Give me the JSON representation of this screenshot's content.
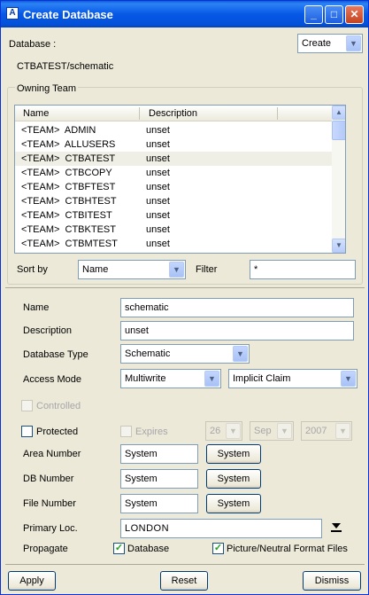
{
  "window": {
    "title": "Create Database",
    "icon_glyph": "A"
  },
  "database": {
    "label": "Database :",
    "mode": "Create",
    "path": "CTBATEST/schematic"
  },
  "owning_team": {
    "legend": "Owning Team",
    "columns": [
      "Name",
      "Description"
    ],
    "rows": [
      {
        "name": "<TEAM>  ADMIN",
        "description": "unset"
      },
      {
        "name": "<TEAM>  ALLUSERS",
        "description": "unset"
      },
      {
        "name": "<TEAM>  CTBATEST",
        "description": "unset",
        "selected": true
      },
      {
        "name": "<TEAM>  CTBCOPY",
        "description": "unset"
      },
      {
        "name": "<TEAM>  CTBFTEST",
        "description": "unset"
      },
      {
        "name": "<TEAM>  CTBHTEST",
        "description": "unset"
      },
      {
        "name": "<TEAM>  CTBITEST",
        "description": "unset"
      },
      {
        "name": "<TEAM>  CTBKTEST",
        "description": "unset"
      },
      {
        "name": "<TEAM>  CTBMTEST",
        "description": "unset"
      }
    ],
    "sort_by_label": "Sort by",
    "sort_by_value": "Name",
    "filter_label": "Filter",
    "filter_value": "*"
  },
  "form": {
    "name_label": "Name",
    "name_value": "schematic",
    "description_label": "Description",
    "description_value": "unset",
    "db_type_label": "Database Type",
    "db_type_value": "Schematic",
    "access_label": "Access Mode",
    "access_value": "Multiwrite",
    "claim_value": "Implicit Claim",
    "controlled_label": "Controlled",
    "protected_label": "Protected",
    "expires_label": "Expires",
    "expires_day": "26",
    "expires_month": "Sep",
    "expires_year": "2007",
    "area_label": "Area Number",
    "area_value": "System",
    "area_button": "System",
    "db_number_label": "DB Number",
    "db_number_value": "System",
    "db_number_button": "System",
    "file_label": "File Number",
    "file_value": "System",
    "file_button": "System",
    "primary_loc_label": "Primary Loc.",
    "primary_loc_value": "LONDON",
    "propagate_label": "Propagate",
    "propagate_db_label": "Database",
    "propagate_pic_label": "Picture/Neutral Format Files",
    "propagate_db_checked": true,
    "propagate_pic_checked": true
  },
  "footer": {
    "apply": "Apply",
    "reset": "Reset",
    "dismiss": "Dismiss"
  },
  "icons": {
    "dropdown": "chevron-down-icon",
    "check": "checkmark-icon",
    "scroll_up": "arrow-up-icon",
    "scroll_down": "arrow-down-icon",
    "location": "underline-arrow-icon"
  }
}
